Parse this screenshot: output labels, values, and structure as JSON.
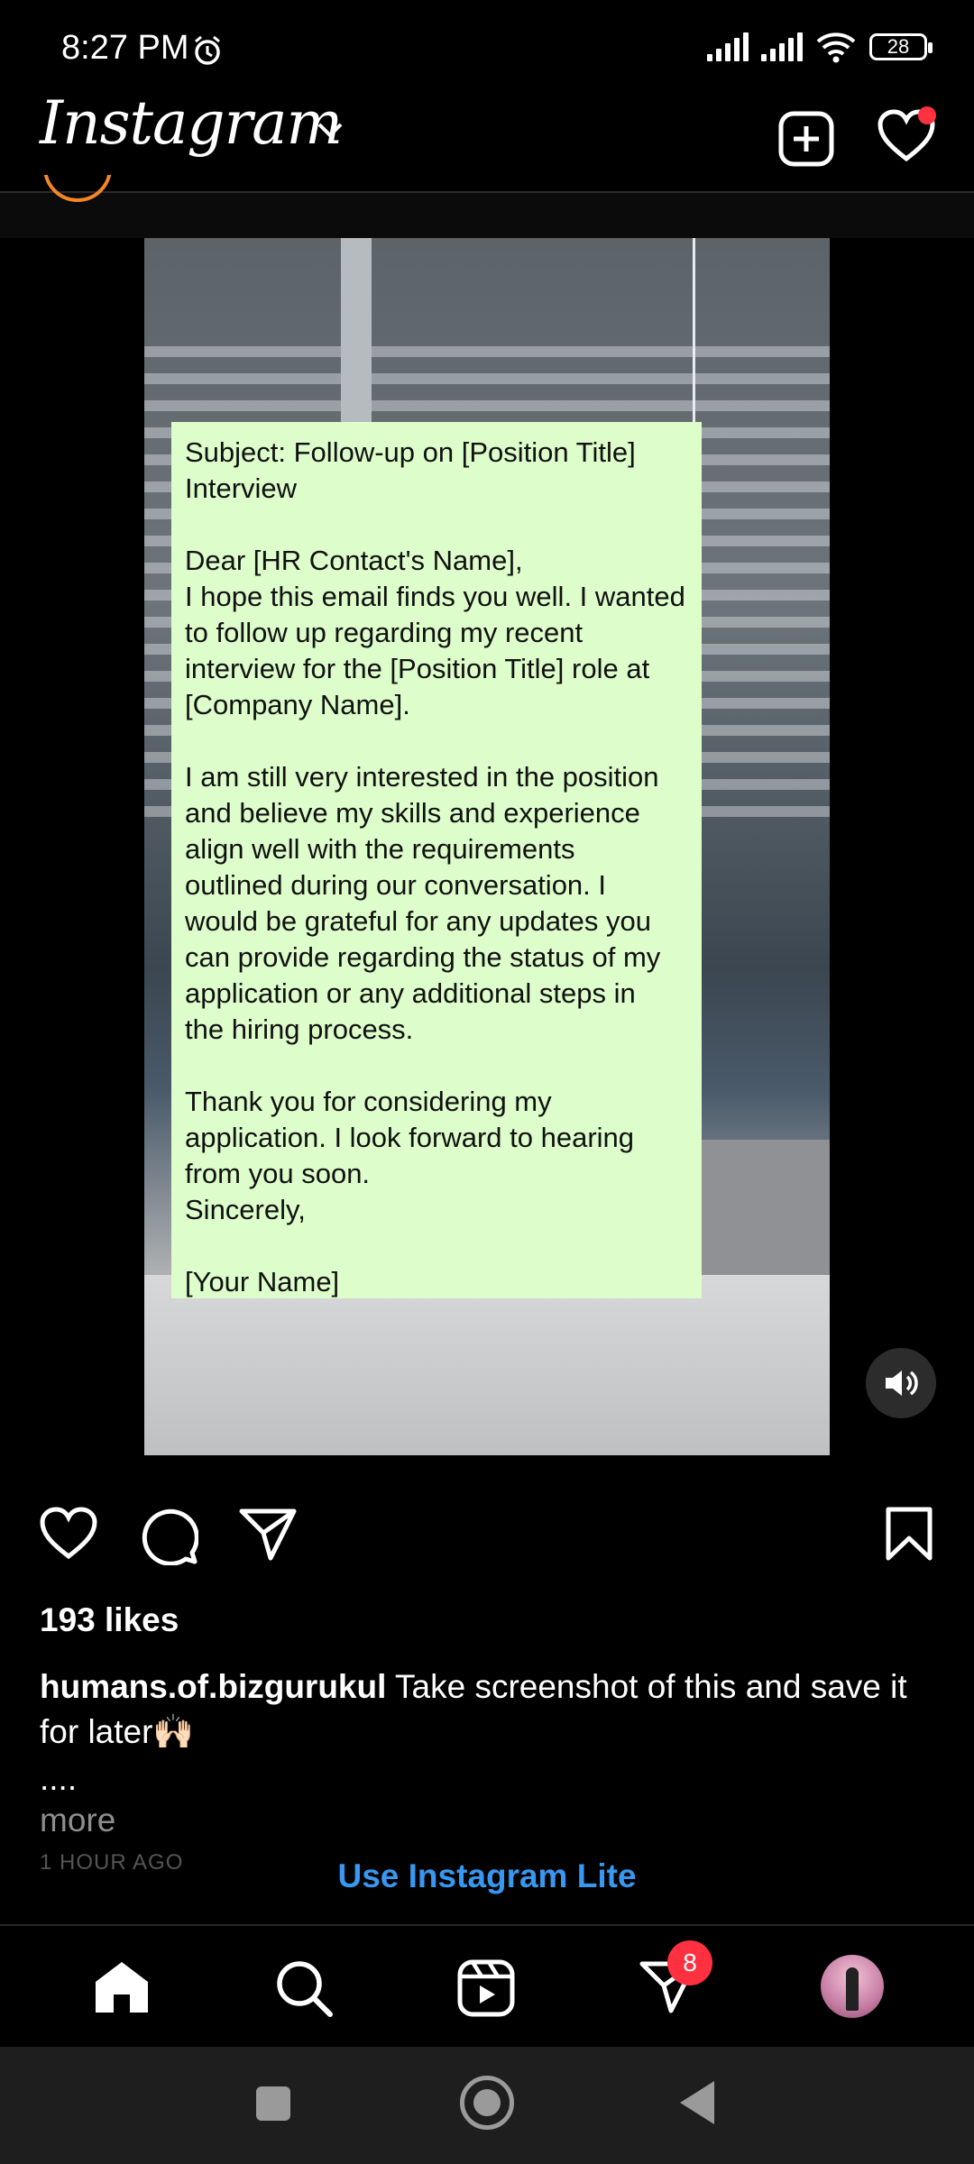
{
  "status_bar": {
    "time": "8:27 PM",
    "battery": "28"
  },
  "header": {
    "logo": "Instagram"
  },
  "post": {
    "note_lines": [
      "Subject: Follow-up on [Position Title]",
      "Interview",
      "",
      "Dear [HR Contact's Name],",
      "I hope this email finds you well. I wanted",
      "to follow up regarding my recent",
      "interview for the [Position Title] role at",
      "[Company Name].",
      "",
      "I am still very interested in the position",
      "and believe my skills and experience",
      "align well with the requirements",
      "outlined during our conversation. I",
      "would be grateful for any updates you",
      "can provide regarding the status of my",
      "application or any additional steps in",
      "the hiring process.",
      "",
      "Thank you for considering my",
      "application. I look forward to hearing",
      "from you soon.",
      "Sincerely,",
      "",
      "[Your Name]"
    ],
    "likes": "193 likes",
    "username": "humans.of.bizgurukul",
    "caption": "Take screenshot of this and save it for later🙌🏻",
    "dots": "....",
    "more": "more",
    "timestamp": "1 HOUR AGO"
  },
  "banner": {
    "lite_link": "Use Instagram Lite"
  },
  "bottom_nav": {
    "dm_badge": "8"
  },
  "colors": {
    "accent": "#3897f0",
    "notification": "#ff3040",
    "note_bg": "#ddfdcb"
  }
}
